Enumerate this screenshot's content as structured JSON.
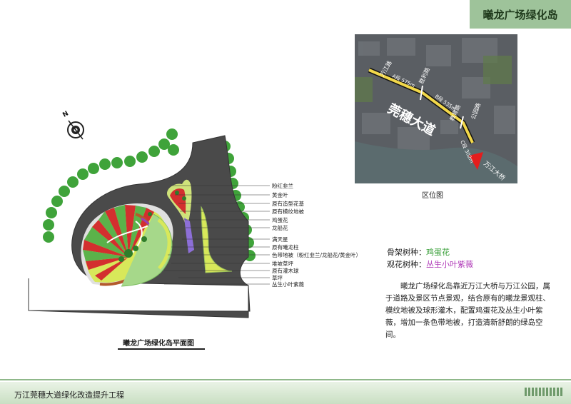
{
  "header": {
    "title": "曦龙广场绿化岛"
  },
  "plan": {
    "caption": "曦龙广场绿化岛平面图",
    "compass_label": "N",
    "legend": [
      "粉红韭兰",
      "黄金叶",
      "原有造型花基",
      "原有模纹地被",
      "鸡蛋花",
      "龙船花",
      "满天星",
      "原有曦龙柱",
      "色带地被（粉红韭兰/龙船花/黄金叶）",
      "堆坡草坪",
      "原有灌木球",
      "草坪",
      "丛生小叶紫薇"
    ]
  },
  "location_map": {
    "caption": "区位图",
    "road_name": "莞穗大道",
    "labels": {
      "wanjiang_road": "万江路",
      "ahead_segment": "A段 575m",
      "shengli_road": "胜利路",
      "b_segment": "B段 535m",
      "jiaoyu_road": "教育路",
      "c_segment": "C段 302m",
      "gongyuan_road": "公园路",
      "wanjiang_bridge": "万江大桥"
    }
  },
  "species": {
    "skeleton_label": "骨架树种：",
    "skeleton_value": "鸡蛋花",
    "flower_label": "观花树种：",
    "flower_value": "丛生小叶紫薇"
  },
  "description": "曦龙广场绿化岛靠近万江大桥与万江公园，属于道路及景区节点景观，结合原有的曦龙景观柱、模纹地被及球形灌木，配置鸡蛋花及丛生小叶紫薇，增加一条色带地被，打造清新舒朗的绿岛空间。",
  "footer": {
    "project": "万江莞穗大道绿化改造提升工程"
  },
  "colors": {
    "accent": "#9ec39a",
    "green_text": "#2e9a2e",
    "purple_text": "#b03ab8"
  }
}
